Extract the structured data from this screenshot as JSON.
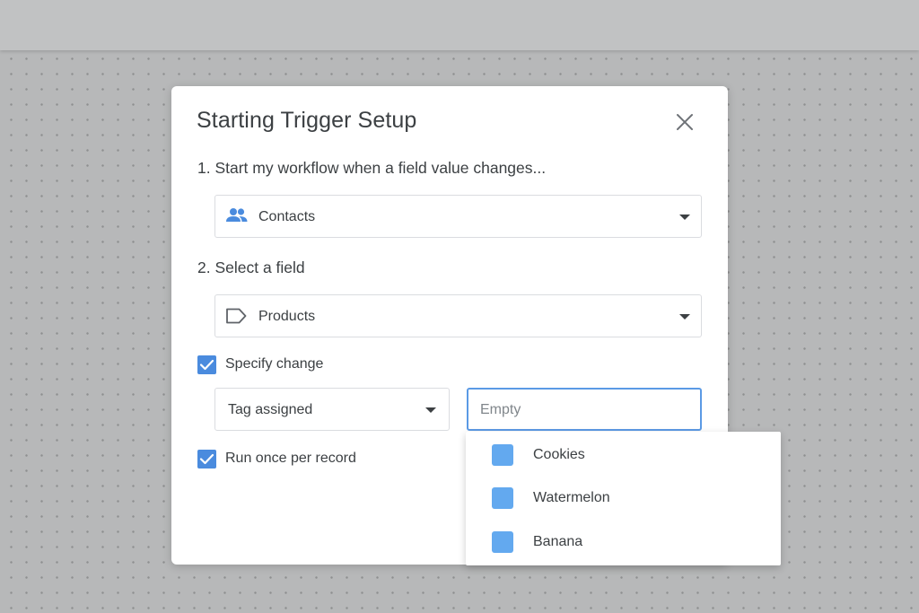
{
  "dialog": {
    "title": "Starting Trigger Setup",
    "step1": {
      "label": "1. Start my workflow when a field value changes...",
      "select_value": "Contacts",
      "icon": "people-icon"
    },
    "step2": {
      "label": "2. Select a field",
      "select_value": "Products",
      "icon": "tag-outline-icon"
    },
    "specify_change": {
      "label": "Specify change",
      "checked": true
    },
    "change_type": {
      "value": "Tag assigned"
    },
    "tag_input": {
      "placeholder": "Empty",
      "value": ""
    },
    "run_once": {
      "label": "Run once per record",
      "checked": true
    }
  },
  "dropdown": {
    "options": [
      {
        "label": "Cookies",
        "color": "#63a9ef"
      },
      {
        "label": "Watermelon",
        "color": "#63a9ef"
      },
      {
        "label": "Banana",
        "color": "#63a9ef"
      }
    ]
  },
  "colors": {
    "accent": "#4a8bde",
    "focus_border": "#5b9ae5"
  }
}
